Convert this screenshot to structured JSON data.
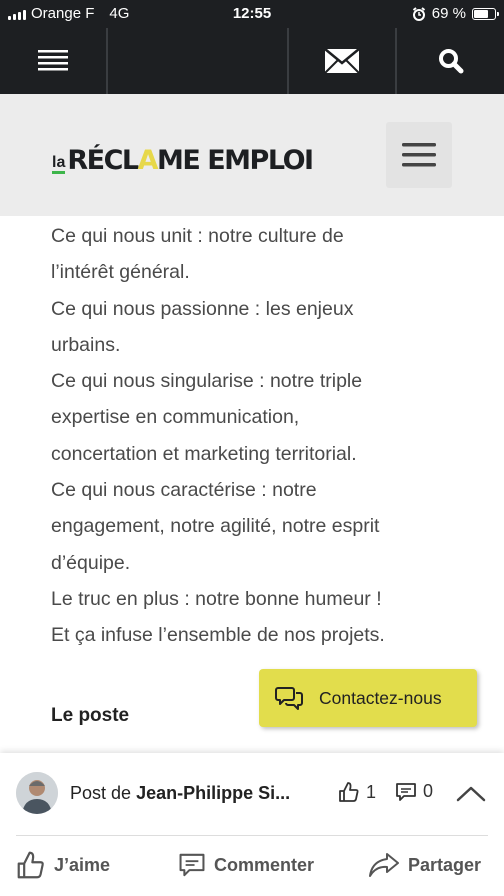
{
  "status_bar": {
    "carrier": "Orange F",
    "network": "4G",
    "time": "12:55",
    "battery": "69 %",
    "battery_level": 0.69,
    "alarm_icon": "alarm-clock-icon"
  },
  "toolbar": {
    "icons": [
      "menu-lines-icon",
      "mail-icon",
      "search-icon"
    ]
  },
  "header": {
    "logo_prefix": "la",
    "logo_part1": "RÉCL",
    "logo_accent": "A",
    "logo_part2": "ME EMPLOI",
    "menu_icon": "hamburger-icon"
  },
  "colors": {
    "accent_yellow": "#e2dd4c",
    "dark_bar": "#1d1f22",
    "logo_green": "#3db54a"
  },
  "article": {
    "lines": [
      "Ce qui nous unit : notre culture de",
      "l’intérêt général.",
      "Ce qui nous passionne : les enjeux",
      "urbains.",
      "Ce qui nous singularise : notre triple",
      "expertise en communication,",
      "concertation et marketing territorial.",
      "Ce qui nous caractérise : notre",
      "engagement, notre agilité, notre esprit",
      "d’équipe.",
      "Le truc en plus : notre bonne humeur !",
      "Et ça infuse l’ensemble de nos projets."
    ],
    "section_heading": "Le poste"
  },
  "contact": {
    "label": "Contactez-nous"
  },
  "post_bar": {
    "prefix": "Post de",
    "author": "Jean-Philippe Si...",
    "likes": "1",
    "comments": "0",
    "actions": {
      "like": "J’aime",
      "comment": "Commenter",
      "share": "Partager"
    }
  }
}
